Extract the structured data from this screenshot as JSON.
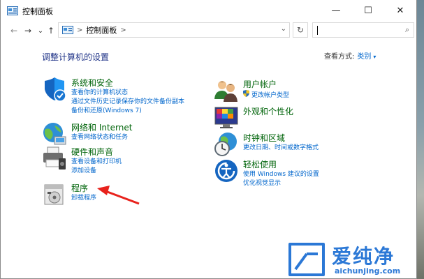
{
  "window": {
    "title": "控制面板",
    "controls": {
      "minimize": "—",
      "maximize": "☐",
      "close": "✕"
    }
  },
  "nav": {
    "back": "←",
    "forward": "→",
    "dropdown": "⌄",
    "up": "↑",
    "address": "控制面板",
    "address_sep": ">",
    "address_dd": "⌄",
    "refresh": "↻",
    "search_placeholder": "",
    "search_icon": "⌕"
  },
  "main": {
    "heading": "调整计算机的设置",
    "view_by_label": "查看方式:",
    "view_by_value": "类别",
    "view_by_dd": "▾"
  },
  "categories_left": [
    {
      "title": "系统和安全",
      "icon": "shield-icon",
      "links": [
        "查看你的计算机状态",
        "通过文件历史记录保存你的文件备份副本",
        "备份和还原(Windows 7)"
      ]
    },
    {
      "title": "网络和 Internet",
      "icon": "network-globe-icon",
      "links": [
        "查看网络状态和任务"
      ]
    },
    {
      "title": "硬件和声音",
      "icon": "printer-icon",
      "links": [
        "查看设备和打印机",
        "添加设备"
      ]
    },
    {
      "title": "程序",
      "icon": "programs-icon",
      "links": [
        "卸载程序"
      ]
    }
  ],
  "categories_right": [
    {
      "title": "用户帐户",
      "icon": "users-icon",
      "links": [
        "更改帐户类型"
      ]
    },
    {
      "title": "外观和个性化",
      "icon": "appearance-icon",
      "links": []
    },
    {
      "title": "时钟和区域",
      "icon": "clock-globe-icon",
      "links": [
        "更改日期、时间或数字格式"
      ]
    },
    {
      "title": "轻松使用",
      "icon": "ease-of-access-icon",
      "links": [
        "使用 Windows 建议的设置",
        "优化视觉显示"
      ]
    }
  ],
  "watermark": {
    "text": "爱纯净",
    "url": "aichunjing.com"
  },
  "colors": {
    "link": "#0066cc",
    "category_title": "#00640a",
    "heading": "#1e3287",
    "watermark": "#2b78d6",
    "arrow": "#e8221c"
  }
}
